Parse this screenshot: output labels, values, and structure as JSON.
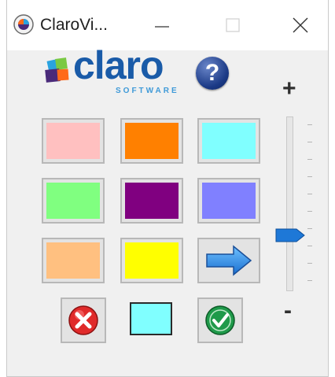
{
  "window": {
    "title": "ClaroVi...",
    "minimize_icon": "minimize-icon",
    "maximize_icon": "maximize-icon",
    "close_icon": "close-icon"
  },
  "logo": {
    "word": "claro",
    "tagline": "SOFTWARE"
  },
  "help": {
    "label": "?"
  },
  "swatches": [
    {
      "name": "pink",
      "color": "#ffc0c0"
    },
    {
      "name": "orange",
      "color": "#ff8000"
    },
    {
      "name": "cyan",
      "color": "#80ffff"
    },
    {
      "name": "green",
      "color": "#80ff80"
    },
    {
      "name": "purple",
      "color": "#800080"
    },
    {
      "name": "periwinkle",
      "color": "#8080ff"
    },
    {
      "name": "peach",
      "color": "#ffc080"
    },
    {
      "name": "yellow",
      "color": "#ffff00"
    }
  ],
  "actions": {
    "next_icon": "right-arrow-icon",
    "cancel_icon": "cancel-x-icon",
    "ok_icon": "ok-check-icon"
  },
  "preview": {
    "color": "#80ffff"
  },
  "opacity": {
    "plus_label": "+",
    "minus_label": "-",
    "level": 0.29,
    "tick_count": 10
  }
}
